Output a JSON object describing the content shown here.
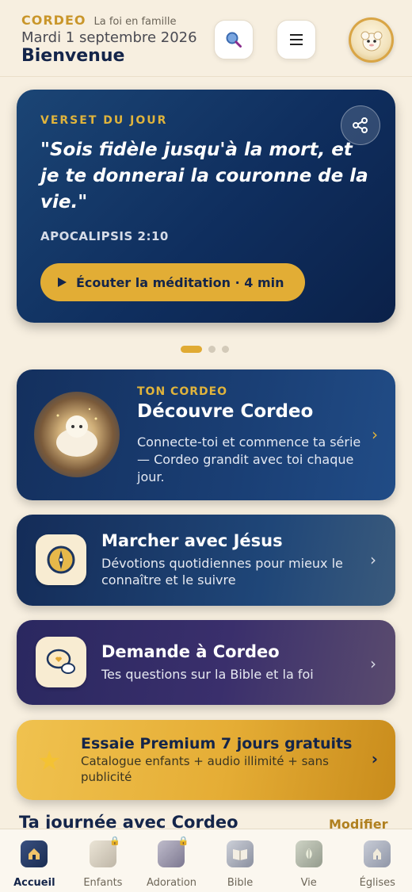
{
  "header": {
    "brand": "CORDEO",
    "tagline": "La foi en famille",
    "date": "Mardi 1 septembre 2026",
    "greeting": "Bienvenue",
    "search_icon": "search-icon",
    "menu_icon": "menu-icon"
  },
  "verse": {
    "label": "VERSET DU JOUR",
    "text": "\"Sois fidèle jusqu'à la mort, et je te donnerai la couronne de la vie.\"",
    "reference": "APOCALIPSIS 2:10",
    "listen_label": "Écouter la méditation · 4 min"
  },
  "carousel": {
    "pages": 3,
    "active_index": 0
  },
  "cards": {
    "cordeo": {
      "eyebrow": "TON CORDEO",
      "title": "Découvre Cordeo",
      "description": "Connecte-toi et commence ta série — Cordeo grandit avec toi chaque jour."
    },
    "marcher": {
      "title": "Marcher avec Jésus",
      "description": "Dévotions quotidiennes pour mieux le connaître et le suivre"
    },
    "demande": {
      "title": "Demande à Cordeo",
      "description": "Tes questions sur la Bible et la foi"
    },
    "premium": {
      "title": "Essaie Premium 7 jours gratuits",
      "description": "Catalogue enfants + audio illimité + sans publicité"
    }
  },
  "section": {
    "title": "Ta journée avec Cordeo",
    "action": "Modifier"
  },
  "nav": [
    {
      "label": "Accueil",
      "active": true,
      "locked": false
    },
    {
      "label": "Enfants",
      "active": false,
      "locked": true
    },
    {
      "label": "Adoration",
      "active": false,
      "locked": true
    },
    {
      "label": "Bible",
      "active": false,
      "locked": false
    },
    {
      "label": "Vie",
      "active": false,
      "locked": false
    },
    {
      "label": "Églises",
      "active": false,
      "locked": false
    }
  ],
  "colors": {
    "accent_gold": "#e2ad35",
    "navy": "#14254a",
    "background": "#f7efe0"
  }
}
